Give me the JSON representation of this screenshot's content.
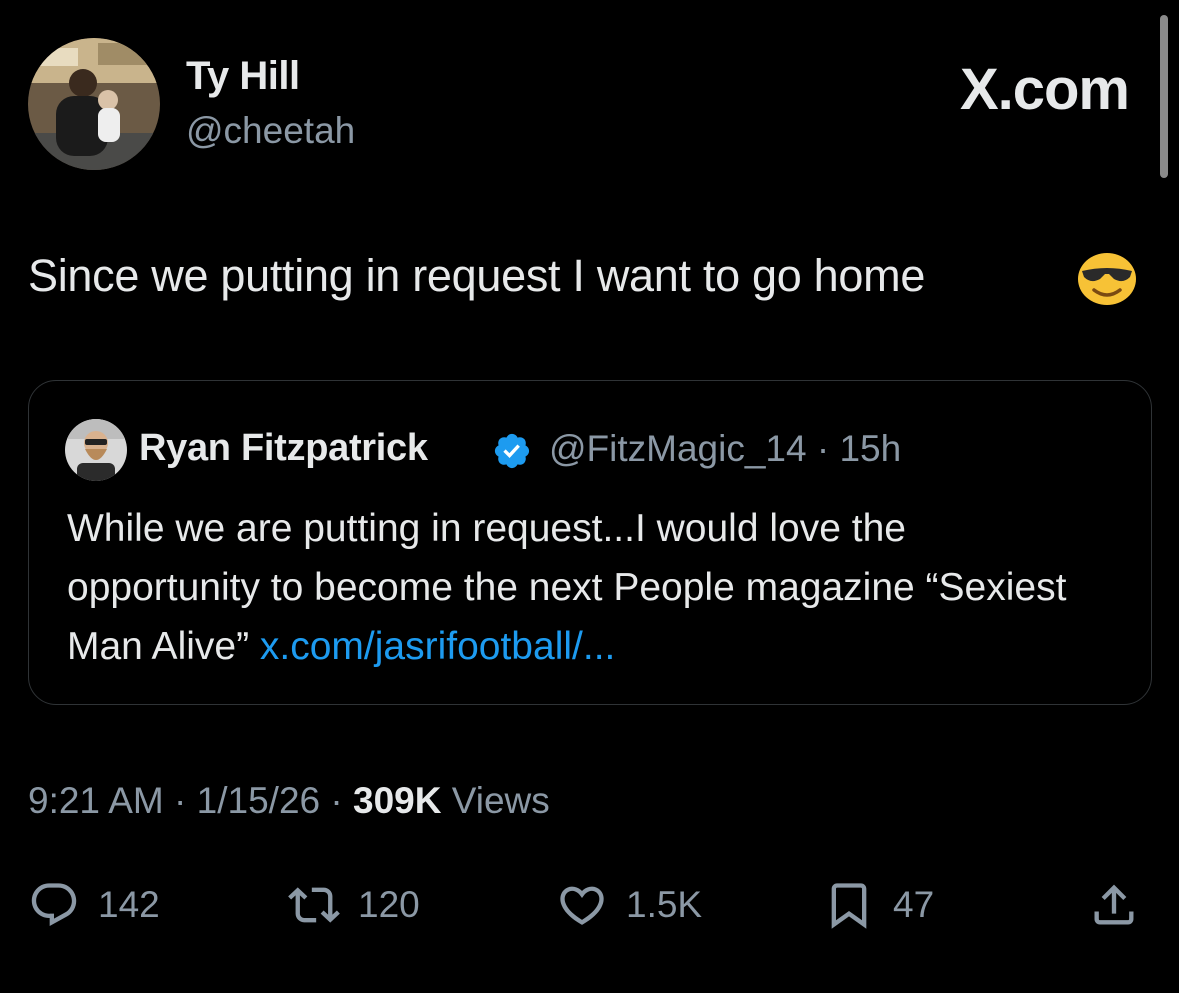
{
  "author": {
    "name": "Ty Hill",
    "handle": "@cheetah"
  },
  "brand": "X.com",
  "tweet": {
    "text": "Since we putting in request I want to go home",
    "emoji": "smiling-face-with-sunglasses"
  },
  "quoted": {
    "name": "Ryan Fitzpatrick",
    "handle": "@FitzMagic_14",
    "time": "15h",
    "text": "While we are putting in request...I would love the opportunity to become the next People magazine “Sexiest Man Alive” ",
    "link": "x.com/jasrifootball/..."
  },
  "meta": {
    "time": "9:21 AM",
    "date": "1/15/26",
    "views_count": "309K",
    "views_label": "Views"
  },
  "actions": {
    "replies": "142",
    "reposts": "120",
    "likes": "1.5K",
    "bookmarks": "47"
  },
  "colors": {
    "background": "#000000",
    "text": "#e7e9ea",
    "secondary": "#8b98a5",
    "link": "#1d9bf0",
    "verified": "#1d9bf0"
  }
}
